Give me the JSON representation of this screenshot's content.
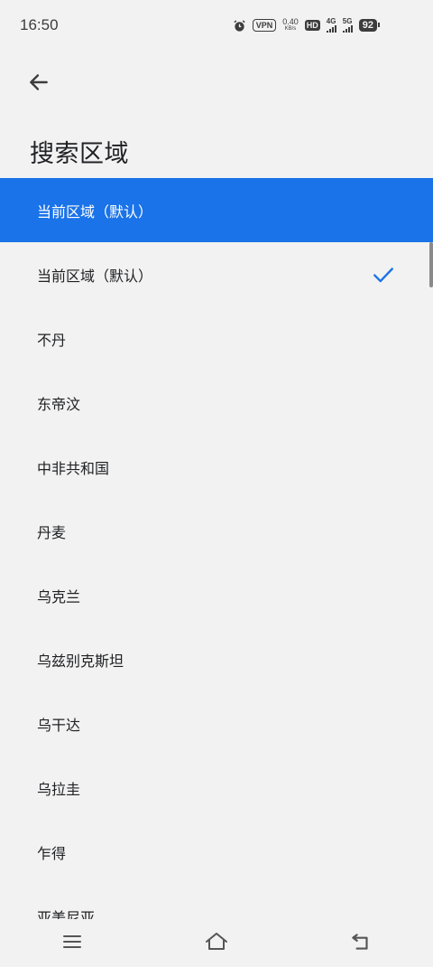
{
  "status_bar": {
    "time": "16:50",
    "vpn": "VPN",
    "speed_value": "0.40",
    "speed_unit": "KB/s",
    "hd": "HD",
    "network1": "4G",
    "network2": "5G",
    "battery": "92"
  },
  "header": {
    "title": "搜索区域"
  },
  "selected_header_label": "当前区域（默认）",
  "regions": [
    {
      "label": "当前区域（默认）",
      "checked": true
    },
    {
      "label": "不丹"
    },
    {
      "label": "东帝汶"
    },
    {
      "label": "中非共和国"
    },
    {
      "label": "丹麦"
    },
    {
      "label": "乌克兰"
    },
    {
      "label": "乌兹别克斯坦"
    },
    {
      "label": "乌干达"
    },
    {
      "label": "乌拉圭"
    },
    {
      "label": "乍得"
    },
    {
      "label": "亚美尼亚"
    }
  ],
  "colors": {
    "accent": "#1a73e8",
    "background": "#f2f2f2"
  }
}
